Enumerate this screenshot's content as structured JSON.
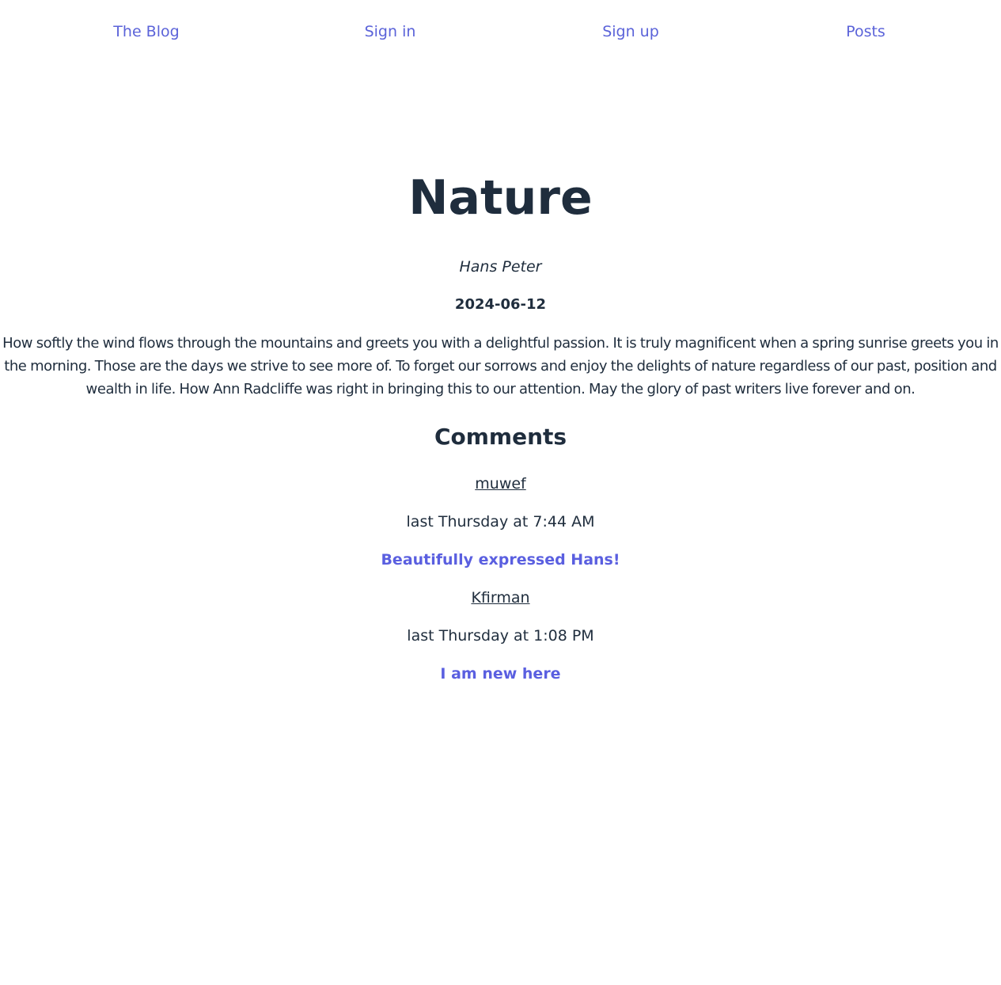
{
  "nav": {
    "brand": "The Blog",
    "sign_in": "Sign in",
    "sign_up": "Sign up",
    "posts": "Posts"
  },
  "post": {
    "title": "Nature",
    "author": "Hans Peter",
    "date": "2024-06-12",
    "body": "How softly the wind flows through the mountains and greets you with a delightful passion. It is truly magnificent when a spring sunrise greets you in the morning. Those are the days we strive to see more of. To forget our sorrows and enjoy the delights of nature regardless of our past, position and wealth in life. How Ann Radcliffe was right in bringing this to our attention. May the glory of past writers live forever and on."
  },
  "comments": {
    "heading": "Comments",
    "items": [
      {
        "user": "muwef",
        "time": "last Thursday at 7:44 AM",
        "text": "Beautifully expressed Hans!"
      },
      {
        "user": "Kfirman",
        "time": "last Thursday at 1:08 PM",
        "text": "I am new here"
      }
    ]
  },
  "colors": {
    "link": "#5b63d9",
    "comment_text": "#5a5fe0",
    "text": "#1f2d3d"
  }
}
